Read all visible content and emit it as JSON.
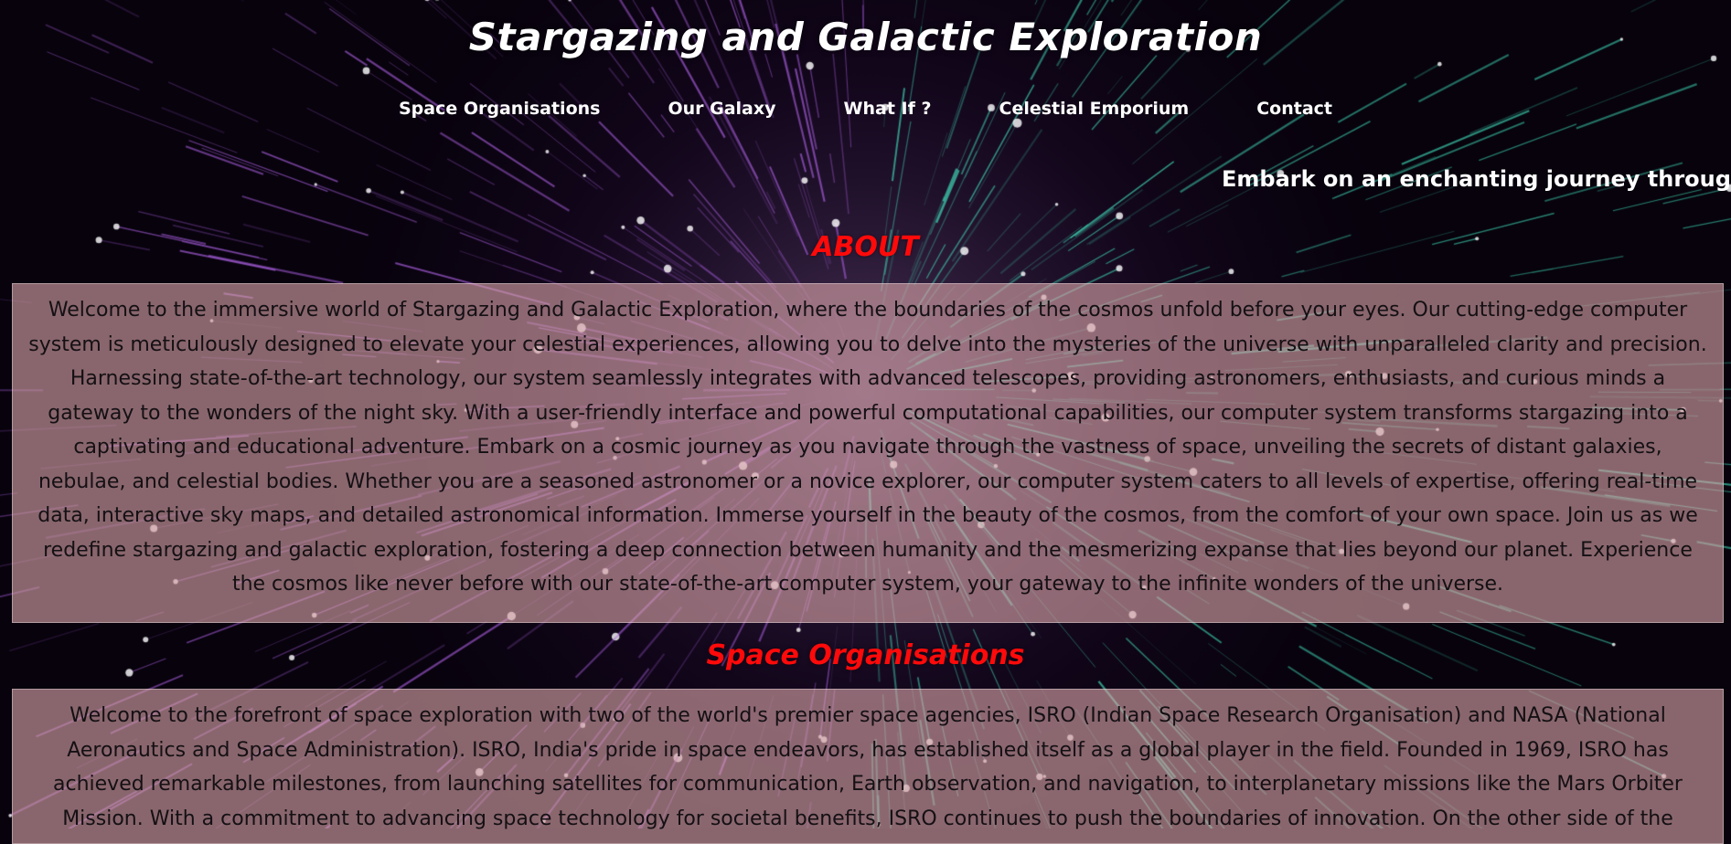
{
  "header": {
    "title": "Stargazing and Galactic Exploration"
  },
  "nav": {
    "items": [
      "Space Organisations",
      "Our Galaxy",
      "What If ?",
      "Celestial Emporium",
      "Contact"
    ]
  },
  "marquee": {
    "text": "Embark on an enchanting journey through the co"
  },
  "about": {
    "heading": "ABOUT",
    "body": "Welcome to the immersive world of Stargazing and Galactic Exploration, where the boundaries of the cosmos unfold before your eyes. Our cutting-edge computer system is meticulously designed to elevate your celestial experiences, allowing you to delve into the mysteries of the universe with unparalleled clarity and precision. Harnessing state-of-the-art technology, our system seamlessly integrates with advanced telescopes, providing astronomers, enthusiasts, and curious minds a gateway to the wonders of the night sky. With a user-friendly interface and powerful computational capabilities, our computer system transforms stargazing into a captivating and educational adventure. Embark on a cosmic journey as you navigate through the vastness of space, unveiling the secrets of distant galaxies, nebulae, and celestial bodies. Whether you are a seasoned astronomer or a novice explorer, our computer system caters to all levels of expertise, offering real-time data, interactive sky maps, and detailed astronomical information. Immerse yourself in the beauty of the cosmos, from the comfort of your own space. Join us as we redefine stargazing and galactic exploration, fostering a deep connection between humanity and the mesmerizing expanse that lies beyond our planet. Experience the cosmos like never before with our state-of-the-art computer system, your gateway to the infinite wonders of the universe."
  },
  "space_organisations": {
    "heading": "Space Organisations",
    "body": "Welcome to the forefront of space exploration with two of the world's premier space agencies, ISRO (Indian Space Research Organisation) and NASA (National Aeronautics and Space Administration). ISRO, India's pride in space endeavors, has established itself as a global player in the field. Founded in 1969, ISRO has achieved remarkable milestones, from launching satellites for communication, Earth observation, and navigation, to interplanetary missions like the Mars Orbiter Mission. With a commitment to advancing space technology for societal benefits, ISRO continues to push the boundaries of innovation. On the other side of the"
  },
  "colors": {
    "heading_red": "#ff0a0a",
    "panel_bg": "#daa5aa",
    "page_bg": "#07020c",
    "purple_streaks": "#a35bd6",
    "teal_streaks": "#3fd6b4"
  }
}
